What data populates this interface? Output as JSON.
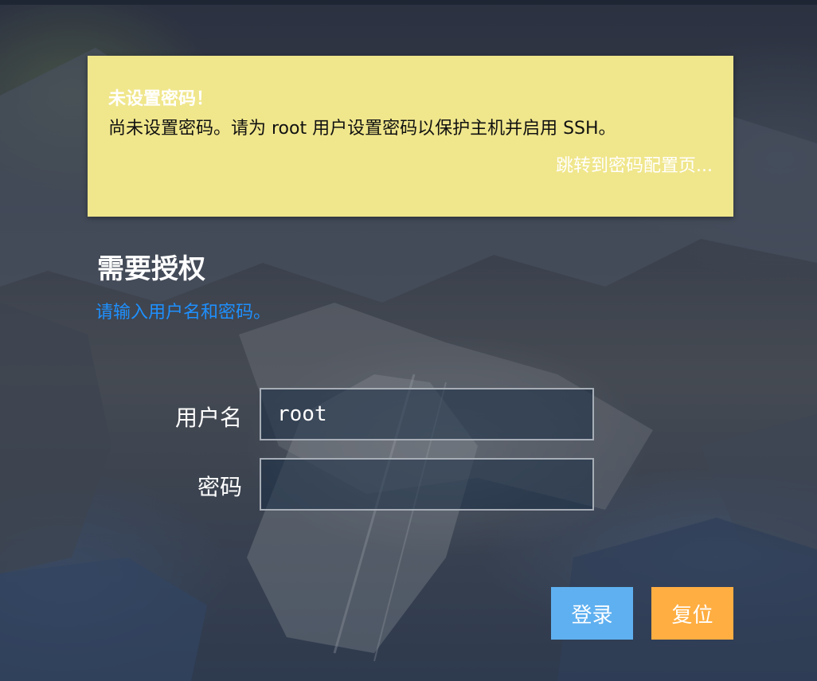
{
  "alert": {
    "title": "未设置密码！",
    "message": "尚未设置密码。请为 root 用户设置密码以保护主机并启用 SSH。",
    "link": "跳转到密码配置页..."
  },
  "auth": {
    "title": "需要授权",
    "description": "请输入用户名和密码。"
  },
  "form": {
    "username_label": "用户名",
    "username_value": "root",
    "password_label": "密码",
    "password_value": ""
  },
  "buttons": {
    "login": "登录",
    "reset": "复位"
  },
  "colors": {
    "alert_background": "#f0e68c",
    "description_text": "#1e90ff",
    "login_button": "#5fb0f0",
    "reset_button": "#ffae42"
  }
}
